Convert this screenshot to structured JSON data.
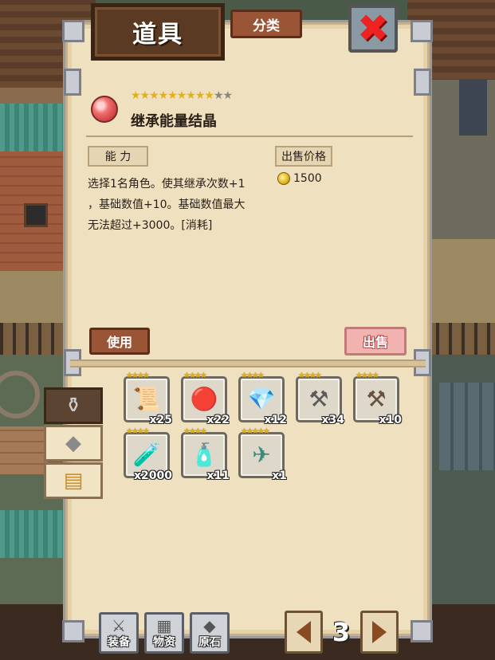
{
  "header": {
    "title": "道具",
    "category_label": "分类"
  },
  "item": {
    "name": "继承能量结晶",
    "stars_filled": "★★★★★★★★★",
    "stars_empty": "★★",
    "rarity": 9,
    "rarity_max": 11,
    "ability_label": "能 力",
    "description_lines": [
      "选择1名角色。使其继承次数+1",
      "，基础数值+10。基础数值最大",
      "无法超过+3000。[消耗]"
    ],
    "sale_price_label": "出售价格",
    "price": "1500"
  },
  "actions": {
    "use_label": "使用",
    "sell_label": "出售"
  },
  "side_tabs": [
    {
      "icon": "bottle-icon",
      "glyph": "⚱",
      "active": true
    },
    {
      "icon": "ore-icon",
      "glyph": "◆",
      "active": false
    },
    {
      "icon": "chest-icon",
      "glyph": "▤",
      "active": false
    }
  ],
  "inventory": [
    {
      "icon": "scroll-book-icon",
      "glyph": "📜",
      "qty": "x25",
      "stars": "★★★★"
    },
    {
      "icon": "pink-orb-icon",
      "glyph": "🔴",
      "qty": "x22",
      "stars": "★★★★"
    },
    {
      "icon": "blue-crystal-icon",
      "glyph": "💎",
      "qty": "x12",
      "stars": "★★★★"
    },
    {
      "icon": "red-anvil-icon",
      "glyph": "⚒",
      "qty": "x34",
      "stars": "★★★★"
    },
    {
      "icon": "bronze-anvil-icon",
      "glyph": "⚒",
      "qty": "x10",
      "stars": "★★★★"
    },
    {
      "icon": "green-potion-icon",
      "glyph": "🧪",
      "qty": "x2000",
      "stars": "★★★★"
    },
    {
      "icon": "yellow-bottle-icon",
      "glyph": "🧴",
      "qty": "x11",
      "stars": "★★★★"
    },
    {
      "icon": "green-ship-icon",
      "glyph": "✈",
      "qty": "x1",
      "stars": "★★★★★"
    }
  ],
  "bottom_nav": {
    "equipment_label": "装备",
    "materials_label": "物资",
    "ore_label": "原石",
    "page_number": "3"
  },
  "colors": {
    "panel_bg": "#efe0bf",
    "button_brown": "#9a5436",
    "sell_pink": "#f2b3b0",
    "close_red": "#ee2222",
    "star_gold": "#e0b11e"
  }
}
